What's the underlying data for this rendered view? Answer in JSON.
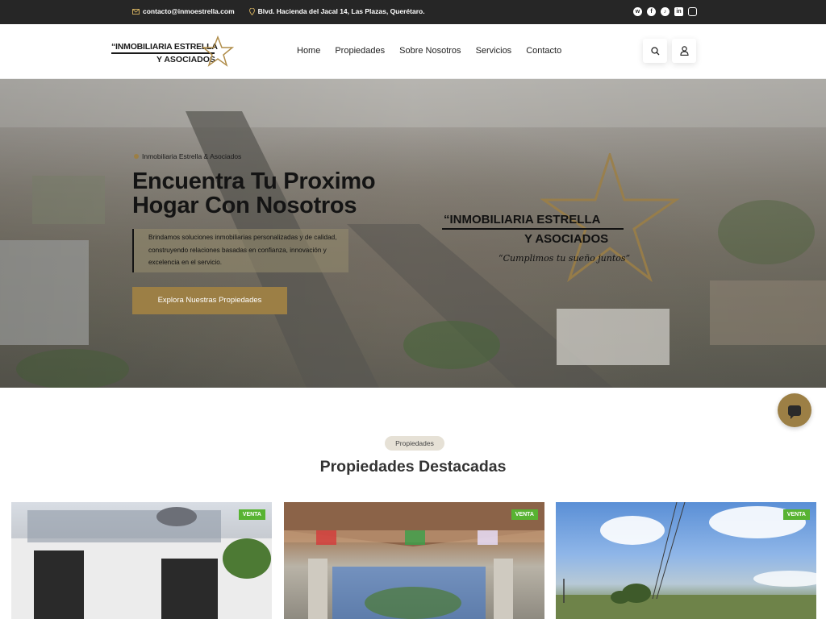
{
  "topbar": {
    "email": "contacto@inmoestrella.com",
    "address": "Blvd. Hacienda del Jacal 14, Las Plazas, Querétaro.",
    "socials": [
      "whatsapp-icon",
      "facebook-icon",
      "tiktok-icon",
      "linkedin-icon",
      "instagram-icon"
    ]
  },
  "header": {
    "logo_line1": "“INMOBILIARIA ESTRELLA",
    "logo_line2": "Y ASOCIADOS",
    "nav": [
      "Home",
      "Propiedades",
      "Sobre Nosotros",
      "Servicios",
      "Contacto"
    ],
    "search_icon": "search-icon",
    "user_icon": "user-icon"
  },
  "hero": {
    "eyebrow": "Inmobiliaria Estrella & Asociados",
    "title_line1": "Encuentra Tu Proximo",
    "title_line2": "Hogar Con Nosotros",
    "description": "Brindamos soluciones inmobiliarias personalizadas y de calidad, construyendo relaciones basadas en confianza, innovación y excelencia en el servicio.",
    "cta": "Explora Nuestras Propiedades",
    "overlay_logo_line1": "“INMOBILIARIA ESTRELLA",
    "overlay_logo_line2": "Y ASOCIADOS",
    "overlay_tagline": "“Cumplimos tu sueño juntos”"
  },
  "featured": {
    "pill": "Propiedades",
    "title": "Propiedades Destacadas",
    "cards": [
      {
        "badge": "VENTA"
      },
      {
        "badge": "VENTA"
      },
      {
        "badge": "VENTA"
      }
    ]
  },
  "colors": {
    "accent": "#9c7f45",
    "topbar": "#262626",
    "badge": "#58b332"
  }
}
